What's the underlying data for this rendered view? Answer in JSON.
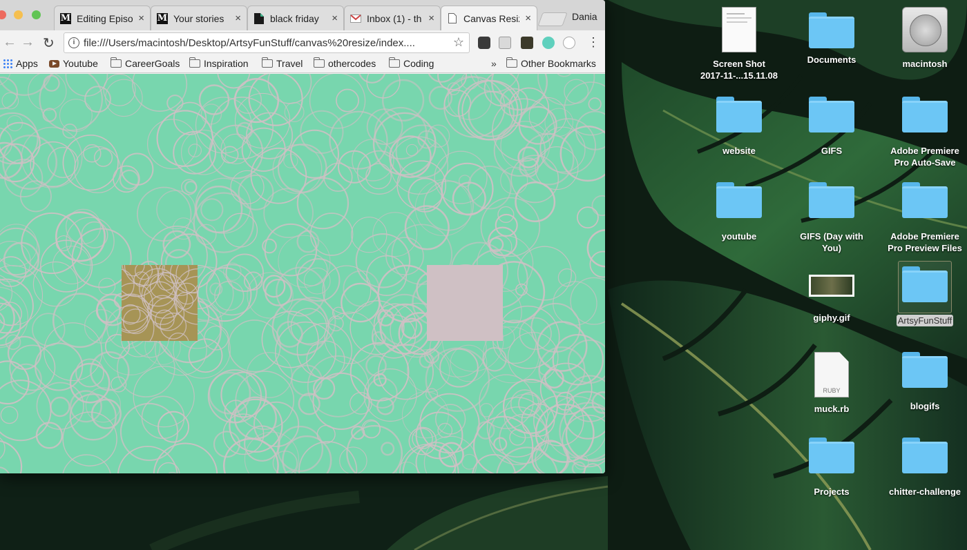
{
  "browser": {
    "tabs": [
      {
        "icon": "medium-icon",
        "title": "Editing Episo",
        "active": false
      },
      {
        "icon": "medium-icon",
        "title": "Your stories",
        "active": false
      },
      {
        "icon": "doc-icon",
        "title": "black friday",
        "active": false
      },
      {
        "icon": "gmail-icon",
        "title": "Inbox (1) - th",
        "active": false
      },
      {
        "icon": "page-icon",
        "title": "Canvas Resiz",
        "active": true
      }
    ],
    "profile_name": "Dania",
    "url": "file:///Users/macintosh/Desktop/ArtsyFunStuff/canvas%20resize/index....",
    "bookmarks": [
      "Apps",
      "Youtube",
      "CareerGoals",
      "Inspiration",
      "Travel",
      "othercodes",
      "Coding"
    ],
    "overflow_chevron": "»",
    "other_bookmarks": "Other Bookmarks",
    "glyphs": {
      "back": "←",
      "forward": "→",
      "reload": "↻",
      "star": "☆",
      "menu": "⋮",
      "close": "×",
      "info": "i",
      "medium": "M"
    }
  },
  "canvas": {
    "background_color": "#78d6ae",
    "circle_color": "#cfc0c4",
    "square_left_color": "#a69456",
    "square_right_color": "#cfc0c4"
  },
  "desktop": {
    "icons": [
      {
        "name": "Screen Shot 2017-11-...15.11.08",
        "lines": [
          "Screen Shot",
          "2017-11-...15.11.08"
        ],
        "kind": "screenshot"
      },
      {
        "name": "Documents",
        "lines": [
          "Documents"
        ],
        "kind": "folder"
      },
      {
        "name": "macintosh",
        "lines": [
          "macintosh"
        ],
        "kind": "drive"
      },
      {
        "name": "website",
        "lines": [
          "website"
        ],
        "kind": "folder"
      },
      {
        "name": "GIFS",
        "lines": [
          "GIFS"
        ],
        "kind": "folder"
      },
      {
        "name": "Adobe Premiere Pro Auto-Save",
        "lines": [
          "Adobe Premiere",
          "Pro Auto-Save"
        ],
        "kind": "folder"
      },
      {
        "name": "youtube",
        "lines": [
          "youtube"
        ],
        "kind": "folder"
      },
      {
        "name": "GIFS (Day with You)",
        "lines": [
          "GIFS (Day with",
          "You)"
        ],
        "kind": "folder"
      },
      {
        "name": "Adobe Premiere Pro Preview Files",
        "lines": [
          "Adobe Premiere",
          "Pro Preview Files"
        ],
        "kind": "folder"
      },
      {
        "name": "giphy.gif",
        "lines": [
          "giphy.gif"
        ],
        "kind": "gif"
      },
      {
        "name": "ArtsyFunStuff",
        "lines": [
          "ArtsyFunStuff"
        ],
        "kind": "folder",
        "selected": true
      },
      {
        "name": "muck.rb",
        "lines": [
          "muck.rb"
        ],
        "kind": "ruby",
        "file_badge": "RUBY"
      },
      {
        "name": "blogifs",
        "lines": [
          "blogifs"
        ],
        "kind": "folder"
      },
      {
        "name": "Projects",
        "lines": [
          "Projects"
        ],
        "kind": "folder"
      },
      {
        "name": "chitter-challenge",
        "lines": [
          "chitter-challenge"
        ],
        "kind": "folder"
      }
    ]
  }
}
